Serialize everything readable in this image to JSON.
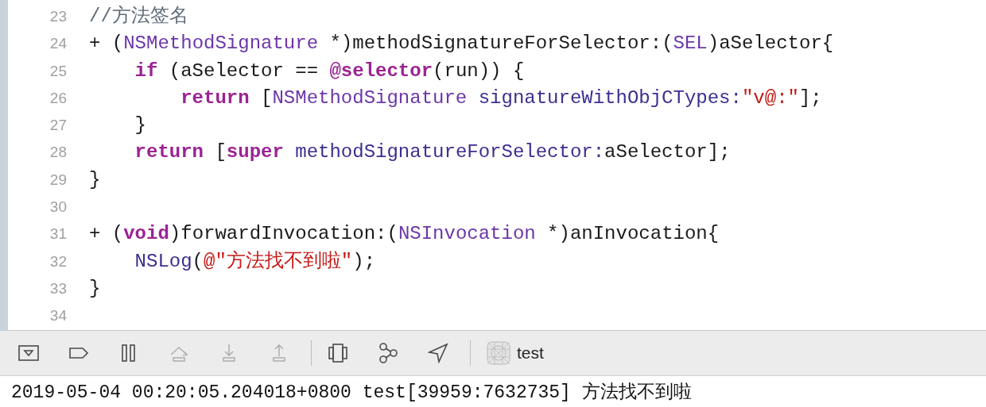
{
  "editor": {
    "lines": [
      {
        "number": "23",
        "tokens": [
          {
            "text": "//方法签名",
            "kind": "comment"
          }
        ]
      },
      {
        "number": "24",
        "tokens": [
          {
            "text": "+ (",
            "kind": "plain"
          },
          {
            "text": "NSMethodSignature",
            "kind": "type"
          },
          {
            "text": " *)methodSignatureForSelector:(",
            "kind": "plain"
          },
          {
            "text": "SEL",
            "kind": "type"
          },
          {
            "text": ")aSelector{",
            "kind": "plain"
          }
        ],
        "children": [
          {
            "number": "25",
            "tokens": [
              {
                "text": "if",
                "kind": "keyword"
              },
              {
                "text": " (aSelector == ",
                "kind": "plain"
              },
              {
                "text": "@selector",
                "kind": "keyword"
              },
              {
                "text": "(run)) {",
                "kind": "plain"
              }
            ],
            "children": [
              {
                "number": "26",
                "tokens": [
                  {
                    "text": "return",
                    "kind": "keyword"
                  },
                  {
                    "text": " [",
                    "kind": "plain"
                  },
                  {
                    "text": "NSMethodSignature",
                    "kind": "type"
                  },
                  {
                    "text": " signatureWithObjCTypes:",
                    "kind": "method"
                  },
                  {
                    "text": "\"v@:\"",
                    "kind": "string"
                  },
                  {
                    "text": "];",
                    "kind": "plain"
                  }
                ]
              }
            ]
          },
          {
            "number": "27",
            "tokens": [
              {
                "text": "}",
                "kind": "plain"
              }
            ]
          },
          {
            "number": "28",
            "tokens": [
              {
                "text": "return",
                "kind": "keyword"
              },
              {
                "text": " [",
                "kind": "plain"
              },
              {
                "text": "super",
                "kind": "keyword"
              },
              {
                "text": " methodSignatureForSelector:",
                "kind": "method"
              },
              {
                "text": "aSelector];",
                "kind": "plain"
              }
            ]
          }
        ]
      },
      {
        "number": "29",
        "tokens": [
          {
            "text": "}",
            "kind": "plain"
          }
        ]
      },
      {
        "number": "30"
      },
      {
        "number": "31",
        "tokens": [
          {
            "text": "+ (",
            "kind": "plain"
          },
          {
            "text": "void",
            "kind": "keyword"
          },
          {
            "text": ")forwardInvocation:(",
            "kind": "plain"
          },
          {
            "text": "NSInvocation",
            "kind": "type"
          },
          {
            "text": " *)anInvocation{",
            "kind": "plain"
          }
        ],
        "children": [
          {
            "number": "32",
            "tokens": [
              {
                "text": "NSLog",
                "kind": "method"
              },
              {
                "text": "(",
                "kind": "plain"
              },
              {
                "text": "@\"方法找不到啦\"",
                "kind": "string"
              },
              {
                "text": ");",
                "kind": "plain"
              }
            ]
          }
        ]
      },
      {
        "number": "33",
        "tokens": [
          {
            "text": "}",
            "kind": "plain"
          }
        ]
      },
      {
        "number": "34"
      }
    ]
  },
  "debug_bar": {
    "items": [
      {
        "kind": "hide-console",
        "disabled": false
      },
      {
        "kind": "breakpoints",
        "disabled": false
      },
      {
        "kind": "pause",
        "disabled": false
      },
      {
        "kind": "step-over",
        "disabled": true
      },
      {
        "kind": "step-into",
        "disabled": true
      },
      {
        "kind": "step-out",
        "disabled": true
      },
      {
        "kind": "separator"
      },
      {
        "kind": "view-hierarchy",
        "disabled": false
      },
      {
        "kind": "memory-graph",
        "disabled": false
      },
      {
        "kind": "location",
        "disabled": false
      },
      {
        "kind": "separator"
      }
    ],
    "target": {
      "label": "test"
    }
  },
  "console": {
    "lines": [
      "2019-05-04 00:20:05.204018+0800 test[39959:7632735] 方法找不到啦"
    ]
  }
}
